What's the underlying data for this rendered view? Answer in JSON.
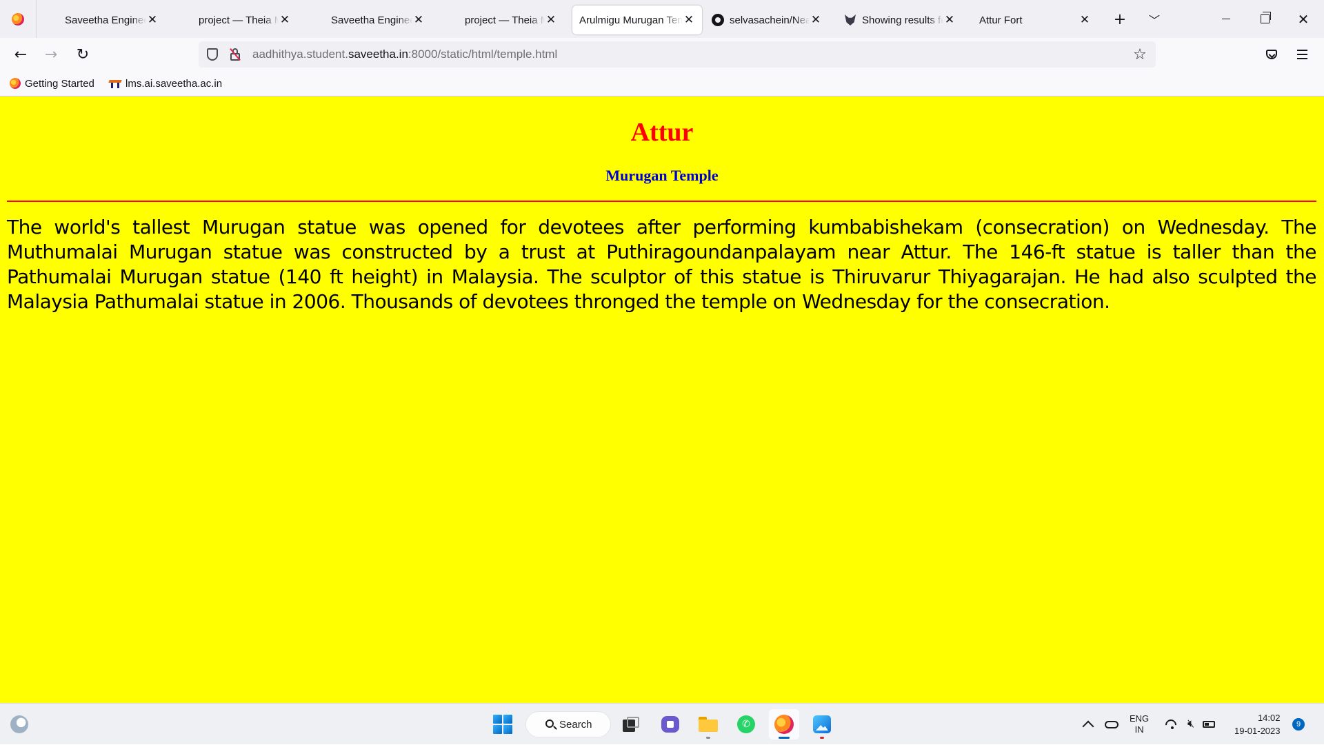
{
  "browser": {
    "tabs": [
      {
        "title": "Saveetha Engineering College",
        "icon": "firefox-icon",
        "active": false
      },
      {
        "title": "project — Theia Multi-Language Workspace",
        "icon": "theia-icon",
        "active": false
      },
      {
        "title": "Saveetha Engineering College",
        "icon": "firefox-icon",
        "active": false
      },
      {
        "title": "project — Theia Multi-Language Workspace",
        "icon": "theia-icon",
        "active": false
      },
      {
        "title": "Arulmigu Murugan Temple",
        "icon": "firefox-icon",
        "active": true
      },
      {
        "title": "selvasachein/NearbyPlaces",
        "icon": "github-icon",
        "active": false
      },
      {
        "title": "Showing results for",
        "icon": "wolf-icon",
        "active": false
      },
      {
        "title": "Attur Fort",
        "icon": "firefox-icon",
        "active": false
      }
    ],
    "new_tab_label": "+",
    "url": {
      "prefix": "aadhithya.student.",
      "host": "saveetha.in",
      "suffix": ":8000/static/html/temple.html"
    },
    "bookmarks": [
      {
        "label": "Getting Started",
        "icon": "firefox-icon"
      },
      {
        "label": "lms.ai.saveetha.ac.in",
        "icon": "lms-icon"
      }
    ]
  },
  "page": {
    "title": "Attur",
    "subtitle": "Murugan Temple",
    "body": "The world's tallest Murugan statue was opened for devotees after performing kumbabishekam (consecration) on Wednesday. The Muthumalai Murugan statue was constructed by a trust at Puthiragoundanpalayam near Attur. The 146-ft statue is taller than the Pathumalai Murugan statue (140 ft height) in Malaysia. The sculptor of this statue is Thiruvarur Thiyagarajan. He had also sculpted the Malaysia Pathumalai statue in 2006. Thousands of devotees thronged the temple on Wednesday for the consecration.",
    "colors": {
      "background": "#ffff00",
      "title": "#ff0000",
      "subtitle": "#0000cc",
      "rule": "#ff0000"
    }
  },
  "taskbar": {
    "search_label": "Search",
    "language": {
      "line1": "ENG",
      "line2": "IN"
    },
    "time": "14:02",
    "date": "19-01-2023",
    "notification_count": "9"
  }
}
